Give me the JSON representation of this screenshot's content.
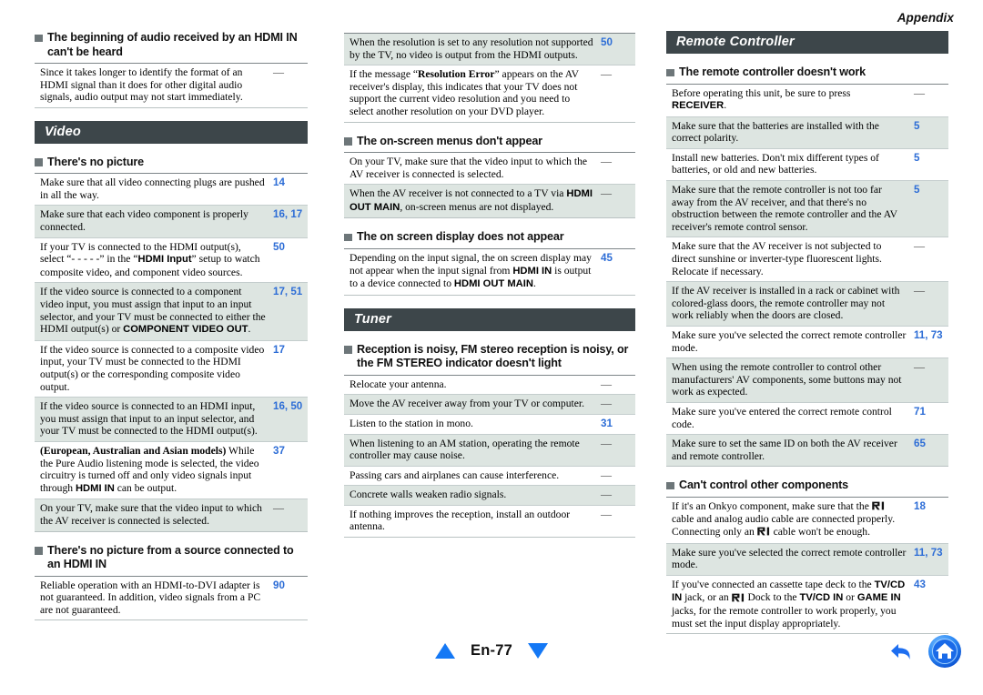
{
  "running_head": "Appendix",
  "footer": {
    "page_label": "En-77",
    "prev_arrow": "up-triangle",
    "next_arrow": "down-triangle",
    "back_icon": "back-arrow-icon",
    "home_icon": "home-icon",
    "accent_color": "#1478f5"
  },
  "columns": {
    "left": {
      "heading_hdmi_audio": "The beginning of audio received by an HDMI IN can't be heard",
      "hdmi_audio_rows": [
        {
          "text": "Since it takes longer to identify the format of an HDMI signal than it does for other digital audio signals, audio output may not start immediately.",
          "page": "—",
          "shaded": false
        }
      ],
      "banner_video": "Video",
      "heading_no_picture": "There's no picture",
      "no_picture_rows": [
        {
          "text": "Make sure that all video connecting plugs are pushed in all the way.",
          "page": "14",
          "shaded": false
        },
        {
          "text": "Make sure that each video component is properly connected.",
          "page": "16, 17",
          "shaded": true
        },
        {
          "text": "If your TV is connected to the HDMI output(s), select “- - - - -” in the “HDMI Input” setup to watch composite video, and component video sources.",
          "page": "50",
          "shaded": false
        },
        {
          "text": "If the video source is connected to a component video input, you must assign that input to an input selector, and your TV must be connected to either the HDMI output(s) or COMPONENT VIDEO OUT.",
          "page": "17, 51",
          "shaded": true
        },
        {
          "text": "If the video source is connected to a composite video input, your TV must be connected to the HDMI output(s) or the corresponding composite video output.",
          "page": "17",
          "shaded": false
        },
        {
          "text": "If the video source is connected to an HDMI input, you must assign that input to an input selector, and your TV must be connected to the HDMI output(s).",
          "page": "16, 50",
          "shaded": true
        },
        {
          "text": "(European, Australian and Asian models) While the Pure Audio listening mode is selected, the video circuitry is turned off and only video signals input through HDMI IN can be output.",
          "page": "37",
          "shaded": false
        },
        {
          "text": "On your TV, make sure that the video input to which the AV receiver is connected is selected.",
          "page": "—",
          "shaded": true
        }
      ],
      "heading_no_picture_hdmi": "There's no picture from a source connected to an HDMI IN",
      "no_picture_hdmi_rows": [
        {
          "text": "Reliable operation with an HDMI-to-DVI adapter is not guaranteed. In addition, video signals from a PC are not guaranteed.",
          "page": "90",
          "shaded": false
        }
      ]
    },
    "mid": {
      "continued_rows": [
        {
          "text": "When the resolution is set to any resolution not supported by the TV, no video is output from the HDMI outputs.",
          "page": "50",
          "shaded": true
        },
        {
          "text": "If the message “Resolution Error” appears on the AV receiver's display, this indicates that your TV does not support the current video resolution and you need to select another resolution on your DVD player.",
          "page": "—",
          "shaded": false
        }
      ],
      "heading_onscreen_menus": "The on-screen menus don't appear",
      "onscreen_menus_rows": [
        {
          "text": "On your TV, make sure that the video input to which the AV receiver is connected is selected.",
          "page": "—",
          "shaded": false
        },
        {
          "text": "When the AV receiver is not connected to a TV via HDMI OUT MAIN, on-screen menus are not displayed.",
          "page": "—",
          "shaded": true
        }
      ],
      "heading_osd": "The on screen display does not appear",
      "osd_rows": [
        {
          "text": "Depending on the input signal, the on screen display may not appear when the input signal from HDMI IN is output to a device connected to HDMI OUT MAIN.",
          "page": "45",
          "shaded": false
        }
      ],
      "banner_tuner": "Tuner",
      "heading_tuner": "Reception is noisy, FM stereo reception is noisy, or the FM STEREO indicator doesn't light",
      "tuner_rows": [
        {
          "text": "Relocate your antenna.",
          "page": "—",
          "shaded": false
        },
        {
          "text": "Move the AV receiver away from your TV or computer.",
          "page": "—",
          "shaded": true
        },
        {
          "text": "Listen to the station in mono.",
          "page": "31",
          "shaded": false
        },
        {
          "text": "When listening to an AM station, operating the remote controller may cause noise.",
          "page": "—",
          "shaded": true
        },
        {
          "text": "Passing cars and airplanes can cause interference.",
          "page": "—",
          "shaded": false
        },
        {
          "text": "Concrete walls weaken radio signals.",
          "page": "—",
          "shaded": true
        },
        {
          "text": "If nothing improves the reception, install an outdoor antenna.",
          "page": "—",
          "shaded": false
        }
      ]
    },
    "right": {
      "banner_remote": "Remote Controller",
      "heading_remote_doesnt_work": "The remote controller doesn't work",
      "remote_rows": [
        {
          "text": "Before operating this unit, be sure to press RECEIVER.",
          "page": "—",
          "shaded": false
        },
        {
          "text": "Make sure that the batteries are installed with the correct polarity.",
          "page": "5",
          "shaded": true
        },
        {
          "text": "Install new batteries. Don't mix different types of batteries, or old and new batteries.",
          "page": "5",
          "shaded": false
        },
        {
          "text": "Make sure that the remote controller is not too far away from the AV receiver, and that there's no obstruction between the remote controller and the AV receiver's remote control sensor.",
          "page": "5",
          "shaded": true
        },
        {
          "text": "Make sure that the AV receiver is not subjected to direct sunshine or inverter-type fluorescent lights. Relocate if necessary.",
          "page": "—",
          "shaded": false
        },
        {
          "text": "If the AV receiver is installed in a rack or cabinet with colored-glass doors, the remote controller may not work reliably when the doors are closed.",
          "page": "—",
          "shaded": true
        },
        {
          "text": "Make sure you've selected the correct remote controller mode.",
          "page": "11, 73",
          "shaded": false
        },
        {
          "text": "When using the remote controller to control other manufacturers' AV components, some buttons may not work as expected.",
          "page": "—",
          "shaded": true
        },
        {
          "text": "Make sure you've entered the correct remote control code.",
          "page": "71",
          "shaded": false
        },
        {
          "text": "Make sure to set the same ID on both the AV receiver and remote controller.",
          "page": "65",
          "shaded": true
        }
      ],
      "heading_cant_control": "Can't control other components",
      "cant_control_rows": [
        {
          "text": "If it's an Onkyo component, make sure that the RI cable and analog audio cable are connected properly. Connecting only an RI cable won't be enough.",
          "page": "18",
          "shaded": false
        },
        {
          "text": "Make sure you've selected the correct remote controller mode.",
          "page": "11, 73",
          "shaded": true
        },
        {
          "text": "If you've connected an cassette tape deck to the TV/CD IN jack, or an RI Dock to the TV/CD IN or GAME IN jacks, for the remote controller to work properly, you must set the input display appropriately.",
          "page": "43",
          "shaded": false
        }
      ]
    }
  },
  "style": {
    "banner_bg": "#3d464a",
    "shade_bg": "#dde5e1",
    "page_number_color": "#2d6dd6",
    "bullet_color": "#6d7679"
  }
}
